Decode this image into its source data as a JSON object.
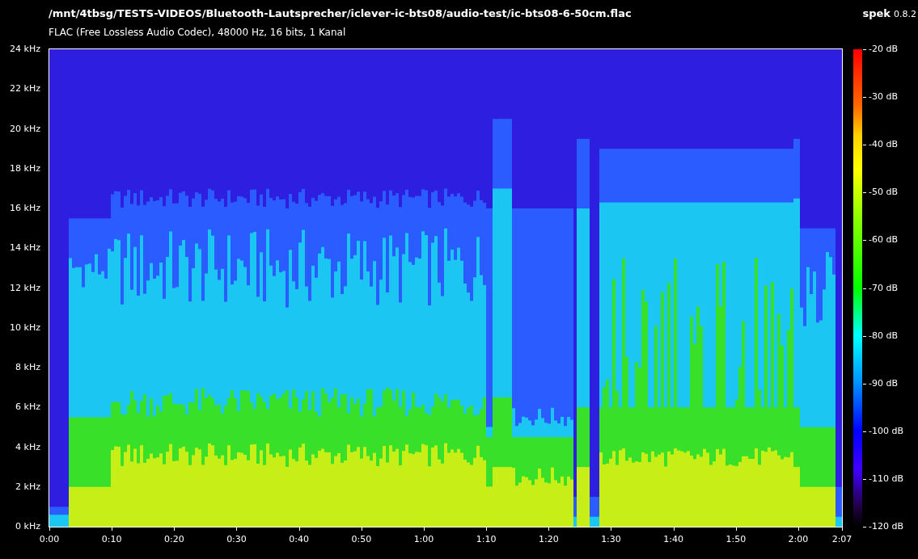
{
  "header": {
    "file_path": "/mnt/4tbsg/TESTS-VIDEOS/Bluetooth-Lautsprecher/iclever-ic-bts08/audio-test/ic-bts08-6-50cm.flac",
    "audio_info": "FLAC (Free Lossless Audio Codec), 48000 Hz, 16 bits, 1 Kanal",
    "app_name": "spek",
    "app_version": "0.8.2"
  },
  "frequency_axis": {
    "ticks": [
      "24 kHz",
      "22 kHz",
      "20 kHz",
      "18 kHz",
      "16 kHz",
      "14 kHz",
      "12 kHz",
      "10 kHz",
      "8 kHz",
      "6 kHz",
      "4 kHz",
      "2 kHz",
      "0 kHz"
    ]
  },
  "time_axis": {
    "ticks": [
      "0:00",
      "0:10",
      "0:20",
      "0:30",
      "0:40",
      "0:50",
      "1:00",
      "1:10",
      "1:20",
      "1:30",
      "1:40",
      "1:50",
      "2:00",
      "2:07"
    ]
  },
  "db_scale": {
    "ticks": [
      "-20 dB",
      "-30 dB",
      "-40 dB",
      "-50 dB",
      "-60 dB",
      "-70 dB",
      "-80 dB",
      "-90 dB",
      "-100 dB",
      "-110 dB",
      "-120 dB"
    ]
  }
}
